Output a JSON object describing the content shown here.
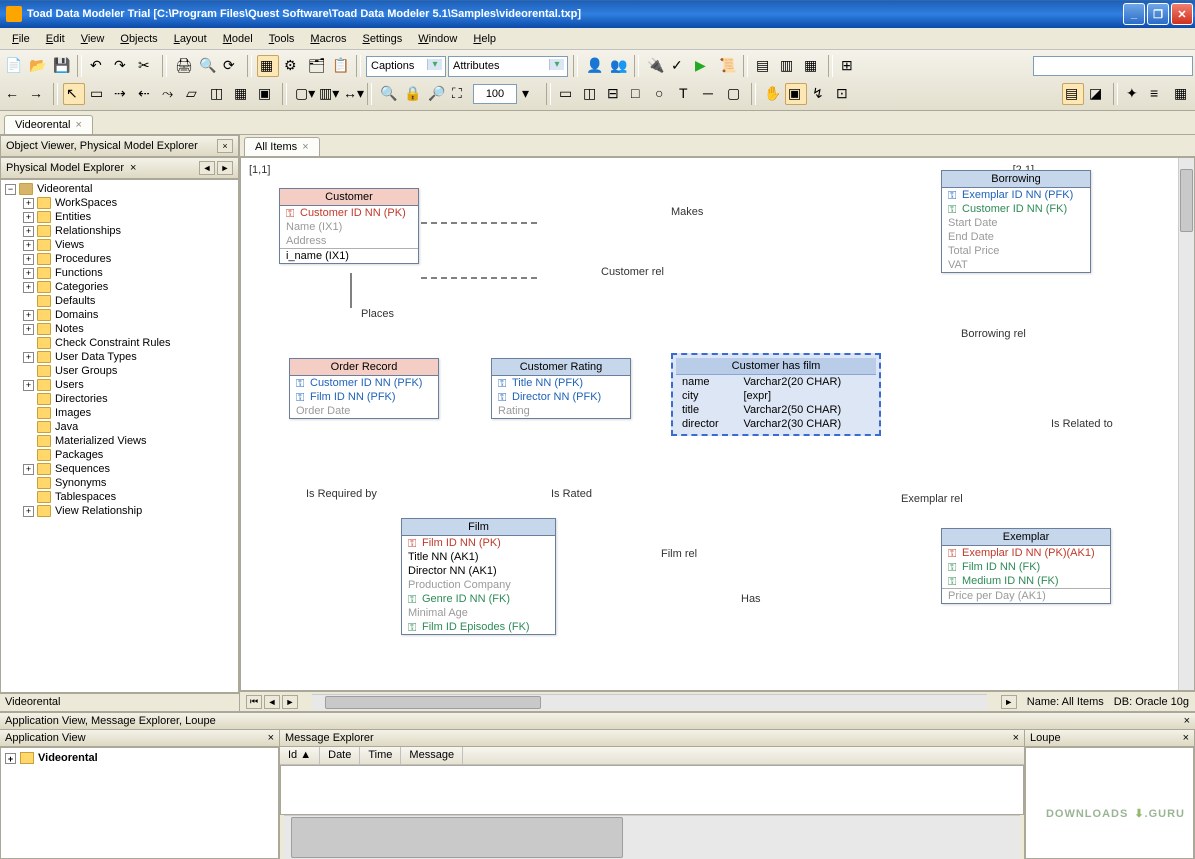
{
  "title": "Toad Data Modeler Trial [C:\\Program Files\\Quest Software\\Toad Data Modeler 5.1\\Samples\\videorental.txp]",
  "menu": [
    "File",
    "Edit",
    "View",
    "Objects",
    "Layout",
    "Model",
    "Tools",
    "Macros",
    "Settings",
    "Window",
    "Help"
  ],
  "toolbar1": {
    "combo1": "Captions",
    "combo2": "Attributes"
  },
  "toolbar2": {
    "zoom": "100"
  },
  "doctab": "Videorental",
  "leftTabsTitle": "Object Viewer, Physical Model Explorer",
  "explorerTab": "Physical Model Explorer",
  "treeRoot": "Videorental",
  "treeItems": [
    {
      "label": "WorkSpaces",
      "expandable": true
    },
    {
      "label": "Entities",
      "expandable": true
    },
    {
      "label": "Relationships",
      "expandable": true
    },
    {
      "label": "Views",
      "expandable": true
    },
    {
      "label": "Procedures",
      "expandable": true
    },
    {
      "label": "Functions",
      "expandable": true
    },
    {
      "label": "Categories",
      "expandable": true
    },
    {
      "label": "Defaults",
      "expandable": false
    },
    {
      "label": "Domains",
      "expandable": true
    },
    {
      "label": "Notes",
      "expandable": true
    },
    {
      "label": "Check Constraint Rules",
      "expandable": false
    },
    {
      "label": "User Data Types",
      "expandable": true
    },
    {
      "label": "User Groups",
      "expandable": false
    },
    {
      "label": "Users",
      "expandable": true
    },
    {
      "label": "Directories",
      "expandable": false
    },
    {
      "label": "Images",
      "expandable": false
    },
    {
      "label": "Java",
      "expandable": false
    },
    {
      "label": "Materialized Views",
      "expandable": false
    },
    {
      "label": "Packages",
      "expandable": false
    },
    {
      "label": "Sequences",
      "expandable": true
    },
    {
      "label": "Synonyms",
      "expandable": false
    },
    {
      "label": "Tablespaces",
      "expandable": false
    },
    {
      "label": "View Relationship",
      "expandable": true
    }
  ],
  "leftStatus": "Videorental",
  "canvasTab": "All Items",
  "coords": {
    "tl": "[1,1]",
    "tr": "[2,1]"
  },
  "tables": {
    "customer": {
      "title": "Customer",
      "rows": [
        {
          "k": "red",
          "txt": "Customer ID NN  (PK)",
          "cls": "txt-red"
        },
        {
          "txt": "Name  (IX1)",
          "cls": "txt-gray"
        },
        {
          "txt": "Address",
          "cls": "txt-gray"
        },
        {
          "txt": "i_name (IX1)",
          "cls": "",
          "topBorder": true
        }
      ]
    },
    "order": {
      "title": "Order Record",
      "rows": [
        {
          "k": "blue",
          "txt": "Customer ID NN  (PFK)",
          "cls": "txt-blue"
        },
        {
          "k": "blue",
          "txt": "Film ID NN  (PFK)",
          "cls": "txt-blue"
        },
        {
          "txt": "Order Date",
          "cls": "txt-gray"
        }
      ]
    },
    "crating": {
      "title": "Customer Rating",
      "rows": [
        {
          "k": "blue",
          "txt": "Title NN  (PFK)",
          "cls": "txt-blue"
        },
        {
          "k": "blue",
          "txt": "Director NN  (PFK)",
          "cls": "txt-blue"
        },
        {
          "txt": "Rating",
          "cls": "txt-gray"
        }
      ]
    },
    "film": {
      "title": "Film",
      "rows": [
        {
          "k": "red",
          "txt": "Film ID NN  (PK)",
          "cls": "txt-red"
        },
        {
          "txt": "Title NN (AK1)"
        },
        {
          "txt": "Director NN (AK1)"
        },
        {
          "txt": "Production Company",
          "cls": "txt-gray"
        },
        {
          "k": "green",
          "txt": "Genre ID NN  (FK)",
          "cls": "txt-green"
        },
        {
          "txt": "Minimal Age",
          "cls": "txt-gray"
        },
        {
          "k": "green",
          "txt": "Film ID Episodes  (FK)",
          "cls": "txt-green"
        }
      ]
    },
    "borrowing": {
      "title": "Borrowing",
      "rows": [
        {
          "k": "blue",
          "txt": "Exemplar ID NN  (PFK)",
          "cls": "txt-blue"
        },
        {
          "k": "green",
          "txt": "Customer ID NN  (FK)",
          "cls": "txt-green"
        },
        {
          "txt": "Start Date",
          "cls": "txt-gray"
        },
        {
          "txt": "End Date",
          "cls": "txt-gray"
        },
        {
          "txt": "Total Price",
          "cls": "txt-gray"
        },
        {
          "txt": "VAT",
          "cls": "txt-gray"
        }
      ]
    },
    "exemplar": {
      "title": "Exemplar",
      "rows": [
        {
          "k": "red",
          "txt": "Exemplar ID NN  (PK)(AK1)",
          "cls": "txt-red"
        },
        {
          "k": "green",
          "txt": "Film ID NN  (FK)",
          "cls": "txt-green"
        },
        {
          "k": "green",
          "txt": "Medium ID NN  (FK)",
          "cls": "txt-green"
        },
        {
          "txt": "Price per Day  (AK1)",
          "cls": "txt-gray",
          "topBorder": true
        }
      ]
    }
  },
  "view": {
    "title": "Customer has film",
    "rows": [
      [
        "name",
        "Varchar2(20 CHAR)"
      ],
      [
        "city",
        "[expr]"
      ],
      [
        "title",
        "Varchar2(50 CHAR)"
      ],
      [
        "director",
        "Varchar2(30 CHAR)"
      ]
    ]
  },
  "labels": {
    "makes": "Makes",
    "customerRel": "Customer rel",
    "places": "Places",
    "borrowingRel": "Borrowing rel",
    "isRequiredBy": "Is Required by",
    "isRated": "Is Rated",
    "isRelatedTo": "Is Related to",
    "exemplarRel": "Exemplar rel",
    "filmRel": "Film rel",
    "has": "Has"
  },
  "canvasStatus": {
    "name": "Name: All Items",
    "db": "DB: Oracle 10g"
  },
  "bottomTabs": "Application View, Message Explorer, Loupe",
  "appViewTitle": "Application View",
  "appViewItem": "Videorental",
  "msgTitle": "Message Explorer",
  "msgCols": [
    "Id",
    "Date",
    "Time",
    "Message"
  ],
  "loupeTitle": "Loupe",
  "watermark1": "DOWNLOADS",
  "watermark2": ".GURU"
}
